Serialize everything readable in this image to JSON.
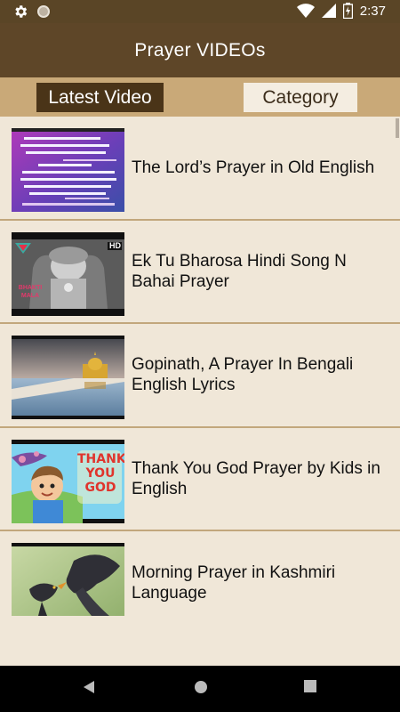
{
  "status_bar": {
    "time": "2:37",
    "icons": [
      "settings-icon",
      "circle-icon",
      "wifi-icon",
      "signal-icon",
      "battery-icon"
    ]
  },
  "app_bar": {
    "title": "Prayer VIDEOs"
  },
  "tabs": [
    {
      "label": "Latest Video",
      "selected": true
    },
    {
      "label": "Category",
      "selected": false
    }
  ],
  "videos": [
    {
      "title": "The Lord’s Prayer in Old English",
      "thumb": "gurmukhi-text-thumbnail"
    },
    {
      "title": "Ek Tu Bharosa Hindi Song N Bahai Prayer",
      "thumb": "statue-thumbnail",
      "badge": "HD",
      "caption": "BHAKTI MALA"
    },
    {
      "title": "Gopinath, A Prayer In Bengali English Lyrics",
      "thumb": "golden-temple-thumbnail"
    },
    {
      "title": "Thank You God Prayer by Kids in English",
      "thumb": "cartoon-kid-thumbnail",
      "caption": "THANK YOU GOD"
    },
    {
      "title": "Morning Prayer in Kashmiri Language",
      "thumb": "birds-thumbnail"
    }
  ],
  "nav_bar": {
    "buttons": [
      "back-icon",
      "home-icon",
      "recents-icon"
    ]
  },
  "colors": {
    "app_bar": "#5e4628",
    "tab_bar": "#c9a978",
    "list_bg": "#f0e7d8",
    "divider": "#c2a77c"
  }
}
